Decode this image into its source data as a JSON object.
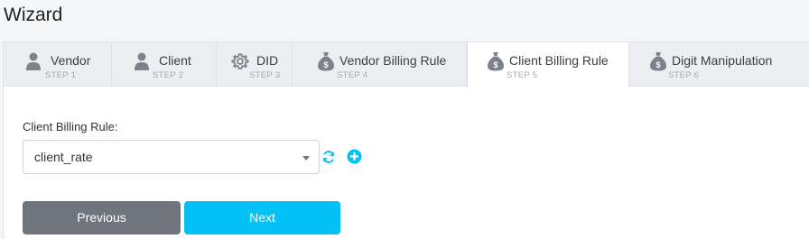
{
  "page": {
    "title": "Wizard"
  },
  "tabs": [
    {
      "label": "Vendor",
      "step": "STEP 1",
      "icon": "user-icon",
      "active": false
    },
    {
      "label": "Client",
      "step": "STEP 2",
      "icon": "user-icon",
      "active": false
    },
    {
      "label": "DID",
      "step": "STEP 3",
      "icon": "gear-icon",
      "active": false
    },
    {
      "label": "Vendor Billing Rule",
      "step": "STEP 4",
      "icon": "money-bag-icon",
      "active": false
    },
    {
      "label": "Client Billing Rule",
      "step": "STEP 5",
      "icon": "money-bag-icon",
      "active": true
    },
    {
      "label": "Digit Manipulation",
      "step": "STEP 6",
      "icon": "money-bag-icon",
      "active": false
    }
  ],
  "form": {
    "field_label": "Client Billing Rule:",
    "selected_value": "client_rate"
  },
  "buttons": {
    "previous": "Previous",
    "next": "Next"
  },
  "colors": {
    "accent": "#03c0f5",
    "secondary": "#70757d",
    "icon_gray": "#7d838c"
  }
}
